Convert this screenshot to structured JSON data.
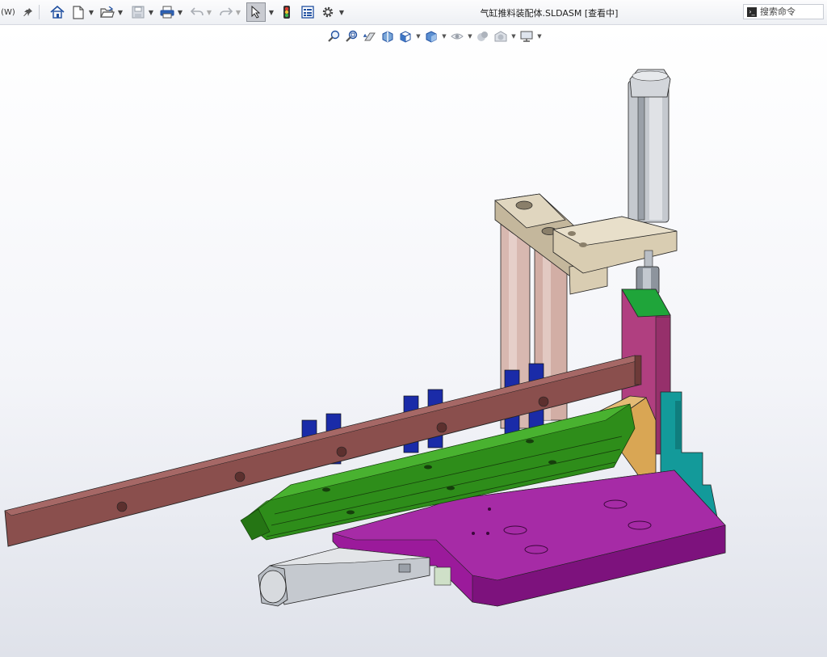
{
  "titlebar": {
    "menu_fragment": "(W)",
    "document_title": "气缸推料装配体.SLDASM [查看中]",
    "search_placeholder": "搜索命令"
  },
  "toolbar": {
    "icons": [
      "pin-icon",
      "home-icon",
      "new-document-icon",
      "open-folder-icon",
      "save-icon",
      "print-icon",
      "undo-icon",
      "redo-icon",
      "select-cursor-icon",
      "traffic-light-icon",
      "file-properties-icon",
      "options-gear-icon"
    ]
  },
  "heads_up_toolbar": {
    "icons": [
      "zoom-to-fit-icon",
      "zoom-to-area-icon",
      "previous-view-icon",
      "section-view-icon",
      "view-orientation-icon",
      "display-style-icon",
      "hide-show-items-icon",
      "edit-appearance-icon",
      "apply-scene-icon",
      "view-settings-icon"
    ]
  },
  "colors": {
    "rail": "#8a4f4d",
    "base_plate": "#9b1a9b",
    "green_guide": "#2e8d1a",
    "column": "#d8b8b0",
    "bracket": "#d9cdb2",
    "block_blue": "#1a2ba8",
    "riser": "#b03f80",
    "cyan_block": "#139a9a",
    "wedge": "#d9a654",
    "cylinder": "#c5c9cf"
  }
}
